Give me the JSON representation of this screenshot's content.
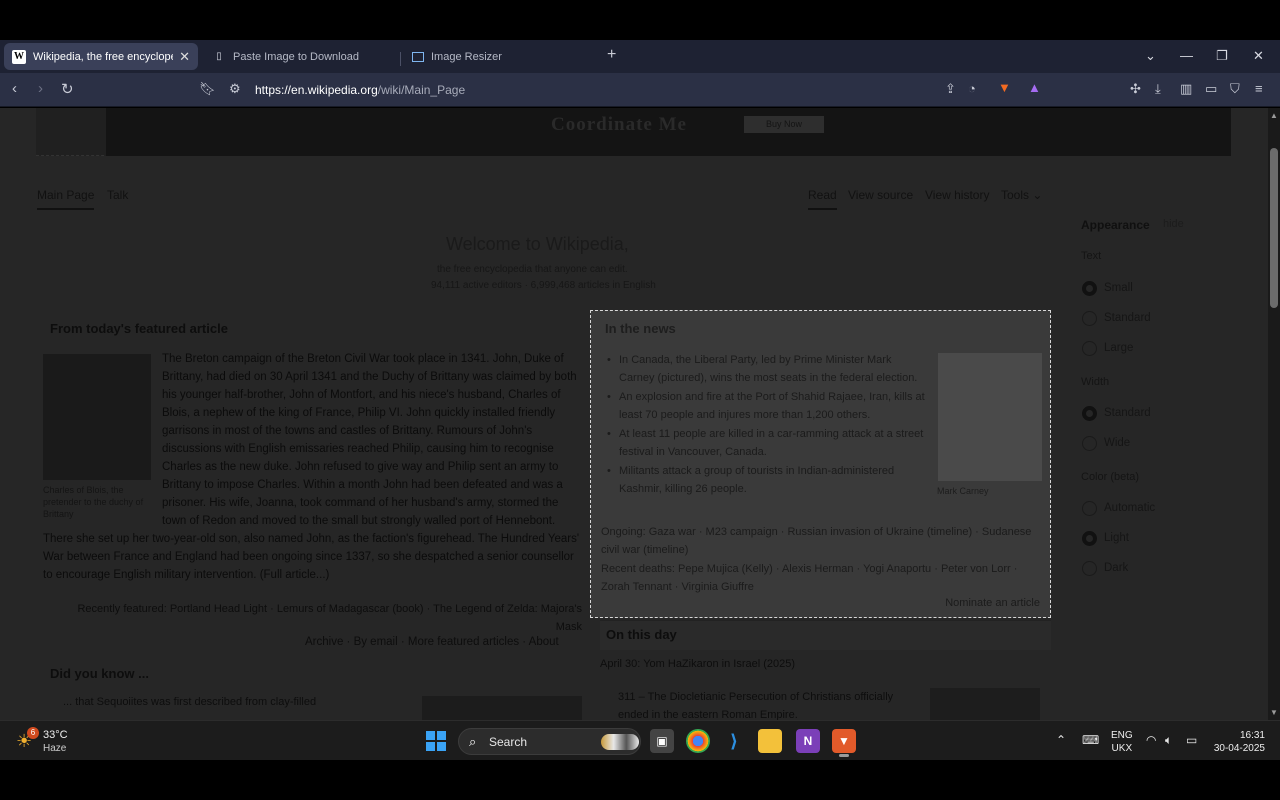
{
  "browser": {
    "tabs": [
      {
        "title": "Wikipedia, the free encyclopedia",
        "active": true
      },
      {
        "title": "Paste Image to Download",
        "active": false
      },
      {
        "title": "Image Resizer",
        "active": false
      }
    ],
    "new_tab": "+",
    "url_domain": "https://en.wikipedia.org",
    "url_path": "/wiki/Main_Page"
  },
  "banner": {
    "brand": "Coordinate Me",
    "button": "Buy Now"
  },
  "subnav": {
    "main_page": "Main Page",
    "talk": "Talk",
    "read": "Read",
    "view_source": "View source",
    "view_history": "View history",
    "tools": "Tools"
  },
  "welcome": {
    "prefix": "Welcome to ",
    "site": "Wikipedia,",
    "line1": "the free encyclopedia that anyone can edit.",
    "line2": "94,111 active editors · 6,999,468 articles in English"
  },
  "featured": {
    "heading": "From today's featured article",
    "caption": "Charles of Blois, the pretender to the duchy of Brittany",
    "text": "The Breton campaign of the Breton Civil War took place in 1341. John, Duke of Brittany, had died on 30 April 1341 and the Duchy of Brittany was claimed by both his younger half-brother, John of Montfort, and his niece's husband, Charles of Blois, a nephew of the king of France, Philip VI. John quickly installed friendly garrisons in most of the towns and castles of Brittany. Rumours of John's discussions with English emissaries reached Philip, causing him to recognise Charles as the new duke. John refused to give way and Philip sent an army to Brittany to impose Charles. Within a month John had been defeated and was a prisoner. His wife, Joanna, took command of her husband's army, stormed the town of Redon and moved to the small but strongly walled port of Hennebont.",
    "text2": "There she set up her two-year-old son, also named John, as the faction's figurehead. The Hundred Years' War between France and England had been ongoing since 1337, so she despatched a senior counsellor to encourage English military intervention. (Full article...)",
    "recent": "Recently featured: Portland Head Light · Lemurs of Madagascar (book) · The Legend of Zelda: Majora's Mask",
    "archive": "Archive · By email · More featured articles · About"
  },
  "dyk": {
    "heading": "Did you know ...",
    "item": "... that Sequoiites was first described from clay-filled"
  },
  "appearance": {
    "heading": "Appearance",
    "hide": "hide",
    "text_label": "Text",
    "text_options": [
      "Small",
      "Standard",
      "Large"
    ],
    "width_label": "Width",
    "width_options": [
      "Standard",
      "Wide"
    ],
    "color_label": "Color (beta)",
    "color_options": [
      "Automatic",
      "Light",
      "Dark"
    ]
  },
  "news": {
    "heading": "In the news",
    "items": [
      "In Canada, the Liberal Party, led by Prime Minister Mark Carney (pictured), wins the most seats in the federal election.",
      "An explosion and fire at the Port of Shahid Rajaee, Iran, kills at least 70 people and injures more than 1,200 others.",
      "At least 11 people are killed in a car-ramming attack at a street festival in Vancouver, Canada.",
      "Militants attack a group of tourists in Indian-administered Kashmir, killing 26 people."
    ],
    "image_caption": "Mark Carney",
    "ongoing": "Ongoing: Gaza war · M23 campaign · Russian invasion of Ukraine (timeline) · Sudanese civil war (timeline)",
    "deaths": "Recent deaths: Pepe Mujica (Kelly) · Alexis Herman · Yogi Anaportu · Peter von Lorr · Zorah Tennant · Virginia Giuffre",
    "nominate": "Nominate an article"
  },
  "otd": {
    "heading": "On this day",
    "date": "April 30: Yom HaZikaron in Israel (2025)",
    "item": "311 – The Diocletianic Persecution of Christians officially ended in the eastern Roman Empire."
  },
  "taskbar": {
    "weather_badge": "6",
    "temp": "33°C",
    "desc": "Haze",
    "search": "Search",
    "lang_line1": "ENG",
    "lang_line2": "UKX",
    "time": "16:31",
    "date": "30-04-2025"
  }
}
